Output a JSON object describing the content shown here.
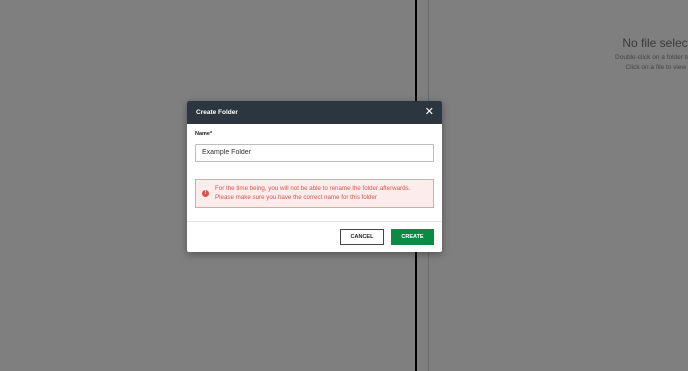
{
  "background": {
    "empty_state": {
      "title": "No file selecte",
      "hint_line1": "Double-click on a folder to view",
      "hint_line2": "Click on a file to view its"
    }
  },
  "dialog": {
    "title": "Create Folder",
    "close_glyph": "✕",
    "field": {
      "label": "Name*",
      "value": "Example Folder"
    },
    "alert": {
      "icon_glyph": "!",
      "line1": "For the time being, you will not be able to rename the folder afterwards.",
      "line2": "Please make sure you have the correct name for this folder"
    },
    "buttons": {
      "cancel_label": "CANCEL",
      "create_label": "CREATE"
    }
  },
  "colors": {
    "header_bg": "#2c3640",
    "primary_green": "#0a8a45",
    "alert_text": "#d0584f",
    "alert_bg": "#fdecec"
  }
}
